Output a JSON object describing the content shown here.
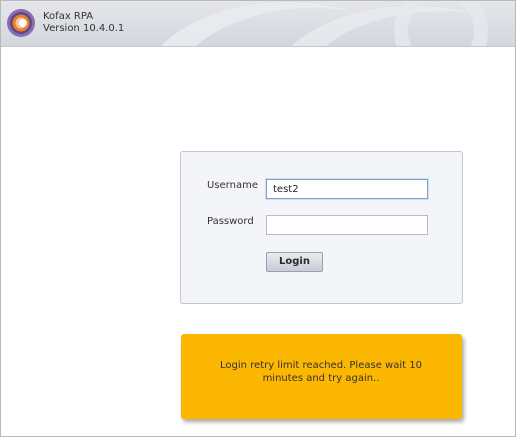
{
  "header": {
    "brand_name": "Kofax RPA",
    "version": "Version 10.4.0.1",
    "logo_icon": "kofax-logo-icon"
  },
  "login": {
    "username_label": "Username",
    "username_value": "test2",
    "password_label": "Password",
    "password_value": "",
    "login_button_label": "Login"
  },
  "alert": {
    "message": "Login retry limit reached. Please wait 10 minutes and try again..",
    "color": "#fbb701"
  }
}
